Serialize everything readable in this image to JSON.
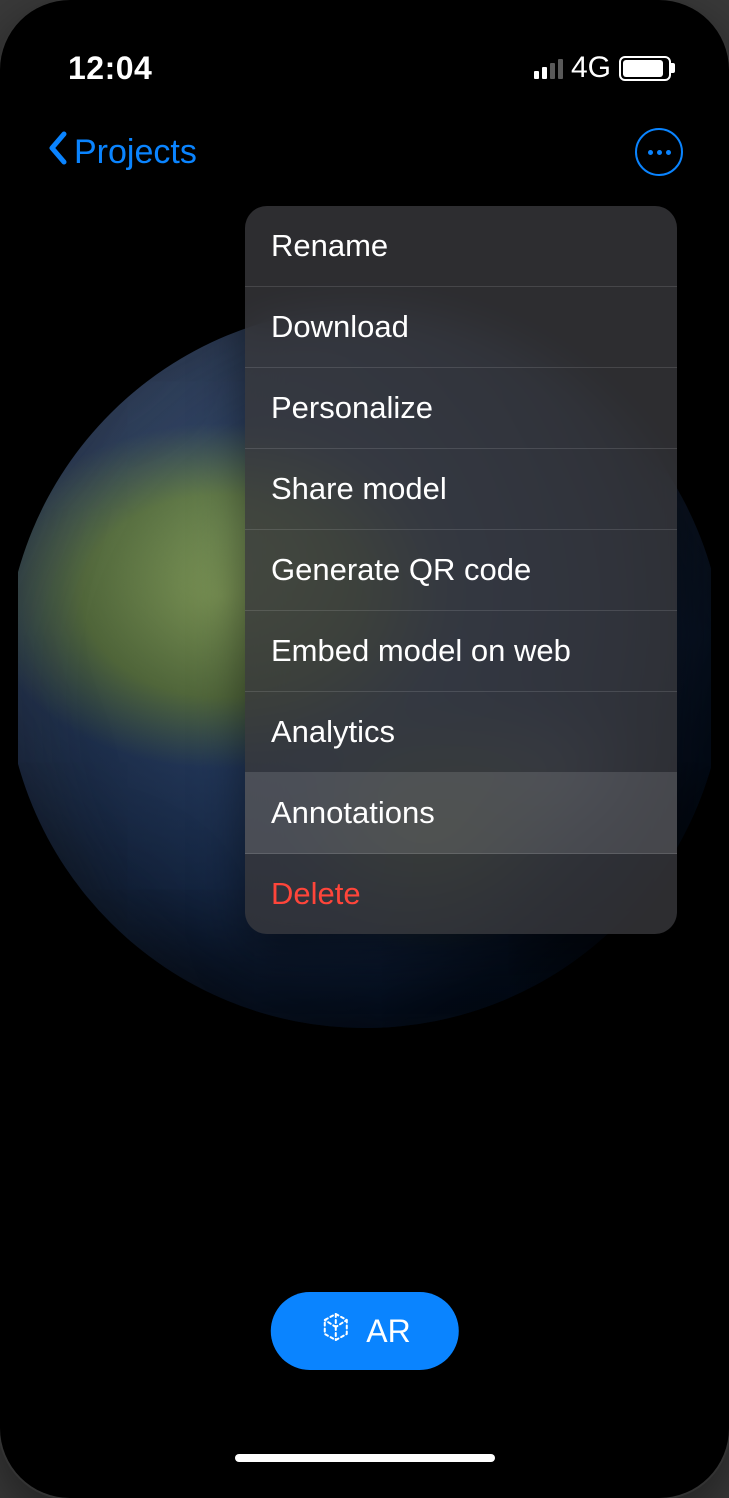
{
  "status": {
    "time": "12:04",
    "network": "4G"
  },
  "nav": {
    "back_label": "Projects"
  },
  "menu": {
    "items": [
      {
        "label": "Rename",
        "destructive": false,
        "highlight": false
      },
      {
        "label": "Download",
        "destructive": false,
        "highlight": false
      },
      {
        "label": "Personalize",
        "destructive": false,
        "highlight": false
      },
      {
        "label": "Share model",
        "destructive": false,
        "highlight": false
      },
      {
        "label": "Generate QR code",
        "destructive": false,
        "highlight": false
      },
      {
        "label": "Embed model on web",
        "destructive": false,
        "highlight": false
      },
      {
        "label": "Analytics",
        "destructive": false,
        "highlight": false
      },
      {
        "label": "Annotations",
        "destructive": false,
        "highlight": true
      },
      {
        "label": "Delete",
        "destructive": true,
        "highlight": false
      }
    ]
  },
  "ar_button": {
    "label": "AR"
  }
}
